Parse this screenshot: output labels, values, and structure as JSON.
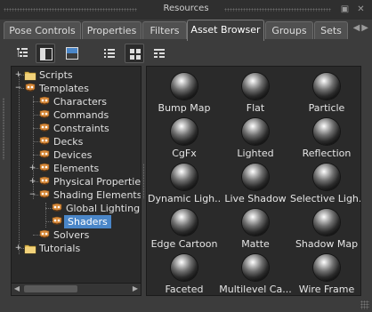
{
  "window": {
    "title": "Resources"
  },
  "tabs": [
    {
      "label": "Pose Controls",
      "active": false
    },
    {
      "label": "Properties",
      "active": false
    },
    {
      "label": "Filters",
      "active": false
    },
    {
      "label": "Asset Browser",
      "active": true
    },
    {
      "label": "Groups",
      "active": false
    },
    {
      "label": "Sets",
      "active": false
    }
  ],
  "tree": {
    "items": [
      {
        "label": "Scripts",
        "icon": "folder-icon",
        "expander": "+"
      },
      {
        "label": "Templates",
        "icon": "template-icon",
        "expander": "−"
      },
      {
        "label": "Characters",
        "icon": "template-icon",
        "expander": ""
      },
      {
        "label": "Commands",
        "icon": "template-icon",
        "expander": ""
      },
      {
        "label": "Constraints",
        "icon": "template-icon",
        "expander": ""
      },
      {
        "label": "Decks",
        "icon": "template-icon",
        "expander": ""
      },
      {
        "label": "Devices",
        "icon": "template-icon",
        "expander": ""
      },
      {
        "label": "Elements",
        "icon": "template-icon",
        "expander": "+"
      },
      {
        "label": "Physical Properties",
        "icon": "template-icon",
        "expander": "+"
      },
      {
        "label": "Shading Elements",
        "icon": "template-icon",
        "expander": "−"
      },
      {
        "label": "Global Lighting Te",
        "icon": "template-icon",
        "expander": ""
      },
      {
        "label": "Shaders",
        "icon": "template-icon",
        "expander": "",
        "selected": true
      },
      {
        "label": "Solvers",
        "icon": "template-icon",
        "expander": ""
      },
      {
        "label": "Tutorials",
        "icon": "folder-icon",
        "expander": "+"
      }
    ]
  },
  "assets": [
    {
      "label": "Bump Map"
    },
    {
      "label": "Flat"
    },
    {
      "label": "Particle"
    },
    {
      "label": "CgFx"
    },
    {
      "label": "Lighted"
    },
    {
      "label": "Reflection"
    },
    {
      "label": "Dynamic Ligh..."
    },
    {
      "label": "Live Shadow"
    },
    {
      "label": "Selective Ligh..."
    },
    {
      "label": "Edge Cartoon"
    },
    {
      "label": "Matte"
    },
    {
      "label": "Shadow Map"
    },
    {
      "label": "Faceted"
    },
    {
      "label": "Multilevel Ca..."
    },
    {
      "label": "Wire Frame"
    }
  ],
  "colors": {
    "selection": "#4a86c8",
    "background": "#3c3c3c",
    "panel": "#2a2a2a"
  }
}
